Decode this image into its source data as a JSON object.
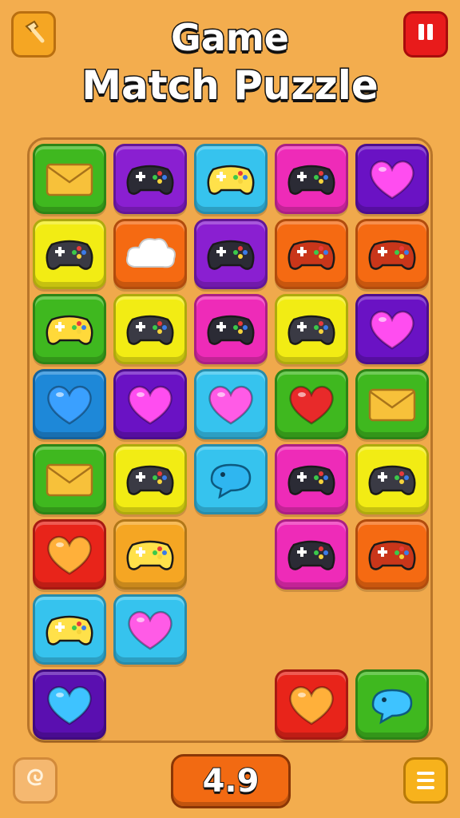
{
  "header": {
    "title_line1": "Game",
    "title_line2": "Match Puzzle",
    "left_button_icon": "hammer-icon",
    "pause_button_icon": "pause-icon"
  },
  "footer": {
    "score": "4.9",
    "hint_button_icon": "swirl-icon",
    "menu_button_icon": "menu-icon"
  },
  "colors": {
    "background": "#f3ad4e",
    "green": "#3fb81f",
    "purple": "#8a1fd1",
    "cyan": "#36c3ee",
    "magenta": "#ee2bb8",
    "violet": "#6a12c4",
    "yellow": "#f2ec14",
    "orange": "#f56a12",
    "red": "#e8241a",
    "blue": "#1e88d8",
    "amber": "#f5a623",
    "dark-violet": "#5a0fb0"
  },
  "board": {
    "columns": 5,
    "rows": 8,
    "tiles": [
      {
        "row": 0,
        "col": 0,
        "color": "green",
        "icon": "envelope-icon"
      },
      {
        "row": 0,
        "col": 1,
        "color": "purple",
        "icon": "gamepad-icon"
      },
      {
        "row": 0,
        "col": 2,
        "color": "cyan",
        "icon": "gamepad-icon"
      },
      {
        "row": 0,
        "col": 3,
        "color": "magenta",
        "icon": "gamepad-icon"
      },
      {
        "row": 0,
        "col": 4,
        "color": "violet",
        "icon": "heart-icon"
      },
      {
        "row": 1,
        "col": 0,
        "color": "yellow",
        "icon": "gamepad-icon"
      },
      {
        "row": 1,
        "col": 1,
        "color": "orange",
        "icon": "cloud-icon"
      },
      {
        "row": 1,
        "col": 2,
        "color": "purple",
        "icon": "gamepad-icon"
      },
      {
        "row": 1,
        "col": 3,
        "color": "orange",
        "icon": "gamepad-icon"
      },
      {
        "row": 1,
        "col": 4,
        "color": "orange",
        "icon": "gamepad-icon"
      },
      {
        "row": 2,
        "col": 0,
        "color": "green",
        "icon": "gamepad-icon"
      },
      {
        "row": 2,
        "col": 1,
        "color": "yellow",
        "icon": "gamepad-icon"
      },
      {
        "row": 2,
        "col": 2,
        "color": "magenta",
        "icon": "gamepad-icon"
      },
      {
        "row": 2,
        "col": 3,
        "color": "yellow",
        "icon": "gamepad-icon"
      },
      {
        "row": 2,
        "col": 4,
        "color": "violet",
        "icon": "heart-icon"
      },
      {
        "row": 3,
        "col": 0,
        "color": "blue",
        "icon": "heart-icon"
      },
      {
        "row": 3,
        "col": 1,
        "color": "violet",
        "icon": "heart-icon"
      },
      {
        "row": 3,
        "col": 2,
        "color": "cyan",
        "icon": "heart-icon"
      },
      {
        "row": 3,
        "col": 3,
        "color": "green",
        "icon": "heart-icon"
      },
      {
        "row": 3,
        "col": 4,
        "color": "green",
        "icon": "envelope-icon"
      },
      {
        "row": 4,
        "col": 0,
        "color": "green",
        "icon": "envelope-icon"
      },
      {
        "row": 4,
        "col": 1,
        "color": "yellow",
        "icon": "gamepad-icon"
      },
      {
        "row": 4,
        "col": 2,
        "color": "cyan",
        "icon": "bubble-icon"
      },
      {
        "row": 4,
        "col": 3,
        "color": "magenta",
        "icon": "gamepad-icon"
      },
      {
        "row": 4,
        "col": 4,
        "color": "yellow",
        "icon": "gamepad-icon"
      },
      {
        "row": 5,
        "col": 0,
        "color": "red",
        "icon": "heart-icon"
      },
      {
        "row": 5,
        "col": 1,
        "color": "amber",
        "icon": "gamepad-icon"
      },
      {
        "row": 5,
        "col": 3,
        "color": "magenta",
        "icon": "gamepad-icon"
      },
      {
        "row": 5,
        "col": 4,
        "color": "orange",
        "icon": "gamepad-icon"
      },
      {
        "row": 6,
        "col": 0,
        "color": "cyan",
        "icon": "gamepad-icon"
      },
      {
        "row": 6,
        "col": 1,
        "color": "cyan",
        "icon": "heart-icon"
      },
      {
        "row": 7,
        "col": 0,
        "color": "dark-violet",
        "icon": "heart-icon"
      },
      {
        "row": 7,
        "col": 3,
        "color": "red",
        "icon": "heart-icon"
      },
      {
        "row": 7,
        "col": 4,
        "color": "green",
        "icon": "bubble-icon"
      }
    ]
  }
}
